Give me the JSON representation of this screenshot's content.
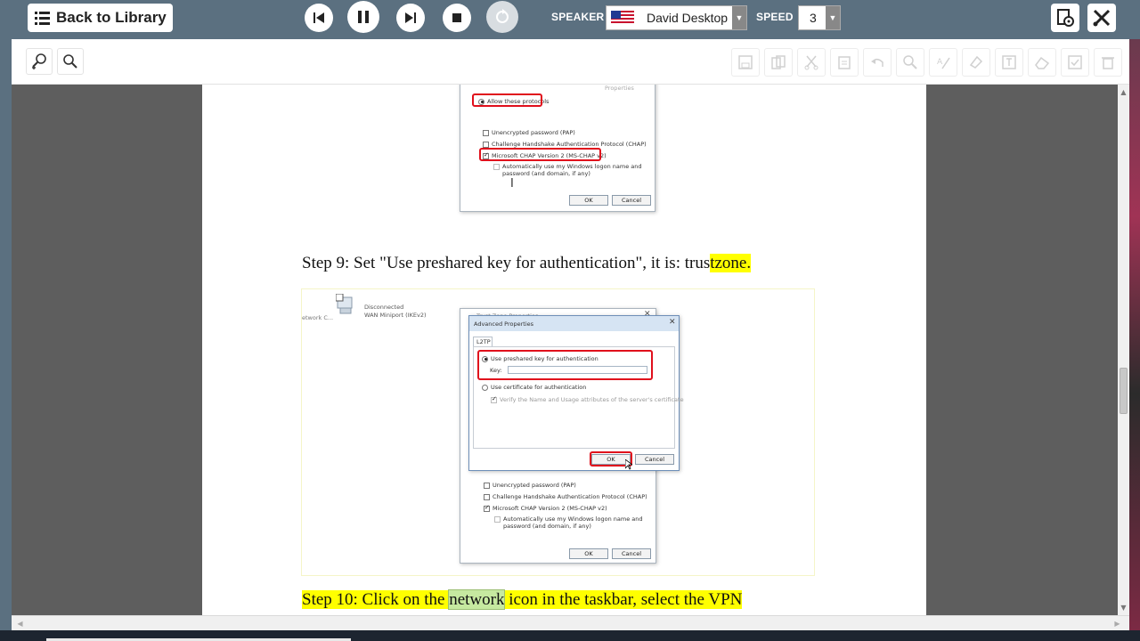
{
  "topbar": {
    "back_label": "Back to Library",
    "speaker_label": "SPEAKER",
    "speaker_value": "David Desktop",
    "speed_label": "SPEED",
    "speed_value": "3",
    "colors": {
      "bar": "#5b7080",
      "button": "#ffffff"
    },
    "icons": [
      "list-icon",
      "skip-back-icon",
      "pause-icon",
      "skip-forward-icon",
      "stop-icon",
      "replay-icon",
      "us-flag-icon",
      "screen-reader-icon",
      "settings-tools-icon"
    ]
  },
  "toolbar2": {
    "zoom_icons": [
      "zoom-in-icon",
      "zoom-out-icon"
    ],
    "edit_icons": [
      "save-icon",
      "copy-icon",
      "cut-icon",
      "paste-icon",
      "undo-icon",
      "find-icon",
      "edit-text-icon",
      "highlight-icon",
      "text-box-icon",
      "erase-icon",
      "check-icon",
      "delete-icon"
    ]
  },
  "document": {
    "shot1": {
      "properties_label": "Properties",
      "allow_protocols": "Allow these protocols",
      "pap": "Unencrypted password (PAP)",
      "chap": "Challenge Handshake Authentication Protocol (CHAP)",
      "mschap": "Microsoft CHAP Version 2 (MS-CHAP v2)",
      "auto_logon_1": "Automatically use my Windows logon name and",
      "auto_logon_2": "password (and domain, if any)",
      "ok": "OK",
      "cancel": "Cancel"
    },
    "step9": {
      "prefix": "Step 9: Set \"Use preshared key for authentication\", it is: trus",
      "highlight": "tzone."
    },
    "shot2": {
      "network_label": "etwork C...",
      "disconnected": "Disconnected",
      "miniport": "WAN Miniport (IKEv2)",
      "bg_title": "Trust Zone Properties",
      "dialog_title": "Advanced Properties",
      "tab_l2tp": "L2TP",
      "use_preshared": "Use preshared key for authentication",
      "key_label": "Key:",
      "use_certificate": "Use certificate for authentication",
      "verify": "Verify the Name and Usage attributes of the server's certificate",
      "ok": "OK",
      "cancel": "Cancel",
      "pap": "Unencrypted password (PAP)",
      "chap": "Challenge Handshake Authentication Protocol (CHAP)",
      "mschap": "Microsoft CHAP Version 2 (MS-CHAP v2)",
      "auto_logon_1": "Automatically use my Windows logon name and",
      "auto_logon_2": "password (and domain, if any)",
      "ok2": "OK",
      "cancel2": "Cancel"
    },
    "step10": {
      "part1": "Step 10: Click on the ",
      "part2": "network",
      "part3": " icon in the taskbar, select the VPN"
    },
    "highlight_color": "#ffff00"
  }
}
